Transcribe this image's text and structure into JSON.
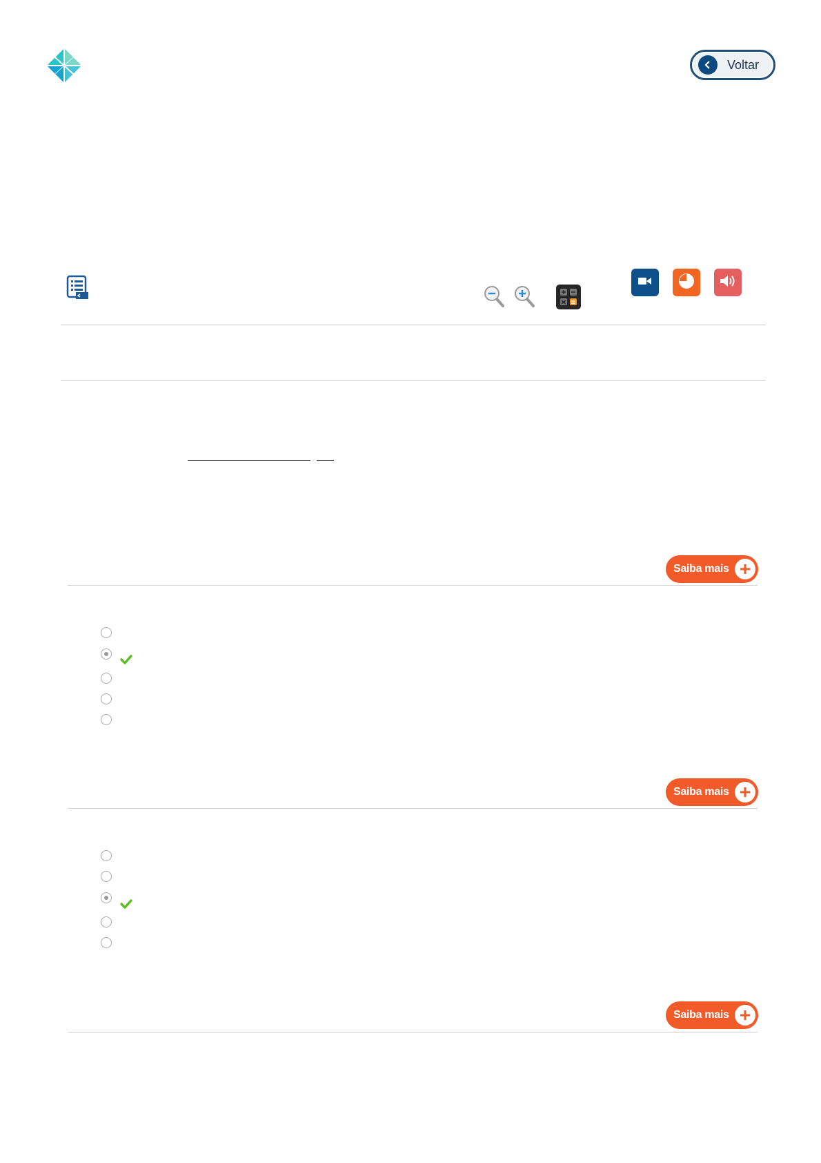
{
  "header": {
    "logo_icon": "diamond-logo-icon",
    "back_label": "Voltar"
  },
  "toolbar": {
    "icons": [
      "document-list-icon",
      "zoom-out-icon",
      "zoom-in-icon",
      "calculator-icon",
      "video-camera-icon",
      "pie-chart-icon",
      "speaker-icon"
    ],
    "colors": {
      "video": "#0d4f8b",
      "pie": "#f26522",
      "audio": "#e45f5f",
      "accent": "#f15a29",
      "check": "#5bbf21"
    }
  },
  "saiba_mais_label": "Saiba mais",
  "questions": [
    {
      "options": 5,
      "selected_index": 1,
      "correct_index": 1
    },
    {
      "options": 5,
      "selected_index": 2,
      "correct_index": 2
    }
  ]
}
